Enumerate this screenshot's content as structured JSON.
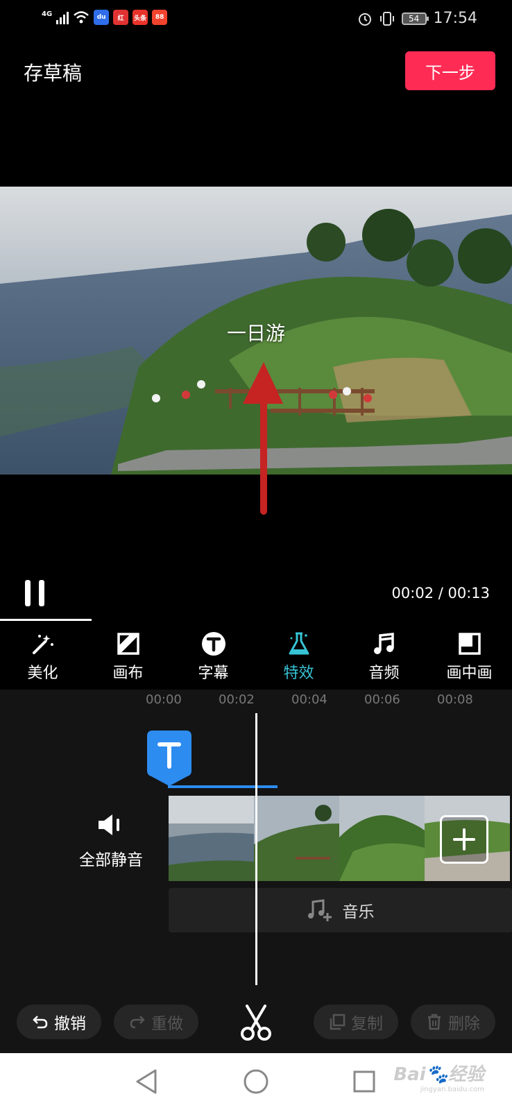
{
  "status_bar": {
    "network": "4G",
    "app_icons": [
      {
        "name": "baidu",
        "text": "du",
        "color": "#2f6dea"
      },
      {
        "name": "app-red",
        "text": "红",
        "color": "#e03232"
      },
      {
        "name": "toutiao",
        "text": "头条",
        "color": "#e8332b"
      },
      {
        "name": "app-orange",
        "text": "88",
        "color": "#f2432e"
      }
    ],
    "battery": "54",
    "time": "17:54"
  },
  "top_bar": {
    "save_draft_label": "存草稿",
    "next_label": "下一步",
    "next_color": "#fe2c55"
  },
  "video": {
    "caption": "一日游"
  },
  "playback": {
    "time": "00:02 / 00:13"
  },
  "tabs": [
    {
      "icon": "magic-wand-icon",
      "label": "美化",
      "active": false
    },
    {
      "icon": "canvas-icon",
      "label": "画布",
      "active": false
    },
    {
      "icon": "text-t-icon",
      "label": "字幕",
      "active": false
    },
    {
      "icon": "flask-icon",
      "label": "特效",
      "active": true
    },
    {
      "icon": "music-note-icon",
      "label": "音频",
      "active": false
    },
    {
      "icon": "picture-in-picture-icon",
      "label": "画中画",
      "active": false
    }
  ],
  "accent_color": "#37c3d6",
  "timeline": {
    "ruler": [
      "00:00",
      "00:02",
      "00:04",
      "00:06",
      "00:08"
    ],
    "mute_label": "全部静音",
    "music_label": "音乐",
    "text_track_color": "#2d8cf0"
  },
  "actions": {
    "undo": "撤销",
    "redo": "重做",
    "copy": "复制",
    "delete": "删除"
  },
  "watermark": {
    "brand": "Bai",
    "brand_suffix": "经验",
    "url": "jingyan.baidu.com"
  }
}
